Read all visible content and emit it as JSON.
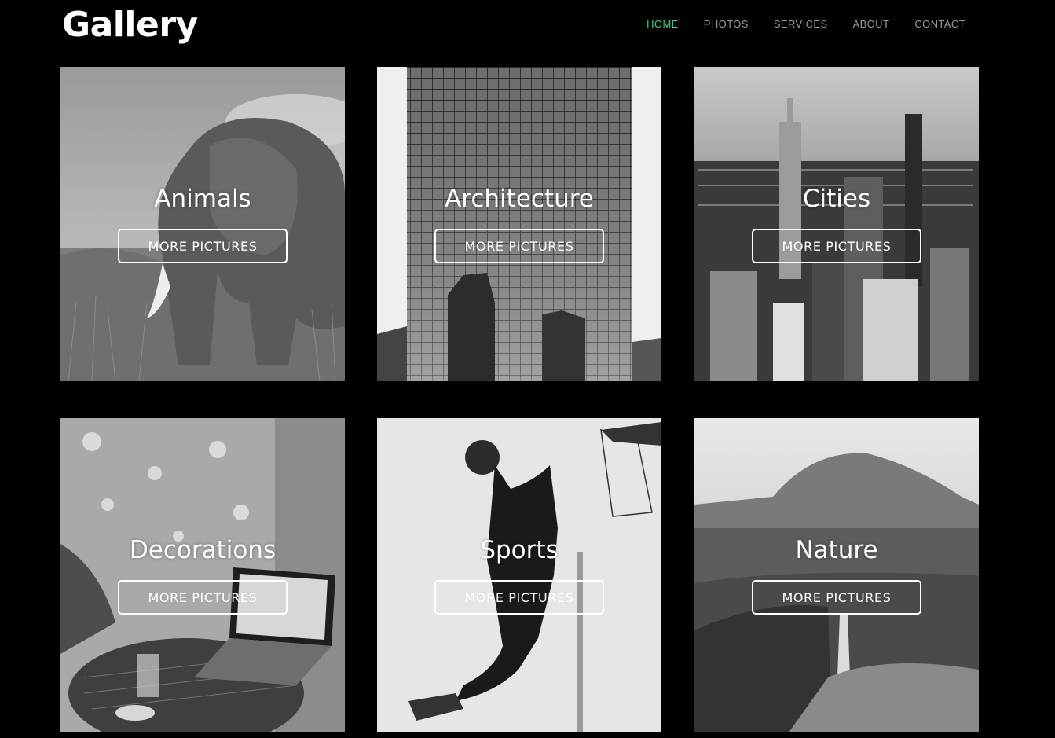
{
  "header": {
    "logo": "Gallery",
    "nav": [
      {
        "label": "HOME",
        "active": true
      },
      {
        "label": "PHOTOS",
        "active": false
      },
      {
        "label": "SERVICES",
        "active": false
      },
      {
        "label": "ABOUT",
        "active": false
      },
      {
        "label": "CONTACT",
        "active": false
      }
    ],
    "active_color": "#3ccf8e",
    "inactive_color": "#9a9a9a"
  },
  "gallery": {
    "cards": [
      {
        "title": "Animals",
        "button": "MORE PICTURES",
        "image": "elephant-photo"
      },
      {
        "title": "Architecture",
        "button": "MORE PICTURES",
        "image": "skyscraper-photo"
      },
      {
        "title": "Cities",
        "button": "MORE PICTURES",
        "image": "city-skyline-photo"
      },
      {
        "title": "Decorations",
        "button": "MORE PICTURES",
        "image": "laptop-cafe-photo"
      },
      {
        "title": "Sports",
        "button": "MORE PICTURES",
        "image": "basketball-dunk-photo"
      },
      {
        "title": "Nature",
        "button": "MORE PICTURES",
        "image": "waterfall-cliff-photo"
      }
    ]
  }
}
